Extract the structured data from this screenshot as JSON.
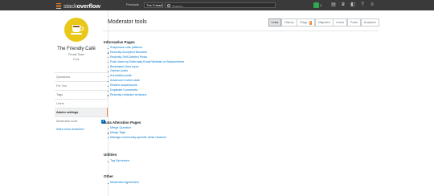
{
  "topbar": {
    "logo_prefix": "stack",
    "logo_brand": "overflow",
    "products_label": "Products",
    "site_name": "The Friendly Café",
    "site_close": "×",
    "search_placeholder": "Search...",
    "reputation": "1",
    "icons": [
      "inbox-icon",
      "achievements-icon",
      "review-icon",
      "help-icon",
      "site-switcher-icon"
    ],
    "colors": {
      "bar": "#3a3a3a",
      "accent": "#f48024"
    }
  },
  "profile": {
    "team_name": "The Friendly Café",
    "private_team_label": "Private Team",
    "role_label": "Free"
  },
  "sidebar": {
    "items": [
      {
        "label": "Questions",
        "active": false
      },
      {
        "label": "For You",
        "active": false
      },
      {
        "label": "Tags",
        "active": false
      },
      {
        "label": "Users",
        "active": false
      },
      {
        "label": "Admin settings",
        "active": true
      },
      {
        "label": "Moderator tools",
        "active": false,
        "badge": "1"
      }
    ],
    "feedback_label": "Want more features?"
  },
  "main": {
    "title": "Moderator tools",
    "tabs": [
      {
        "label": "Links",
        "active": true
      },
      {
        "label": "History",
        "active": false
      },
      {
        "label": "Flags",
        "active": false,
        "count": "1"
      },
      {
        "label": "Migrated",
        "active": false
      },
      {
        "label": "Users",
        "active": false
      },
      {
        "label": "Posts",
        "active": false
      },
      {
        "label": "Analytics",
        "active": false
      }
    ],
    "sections": [
      {
        "heading": "Informative Pages",
        "links": [
          "Suspicious vote patterns",
          "Recently Accepted Bounties",
          "Recently Self-Deleted Posts",
          "Post Users by Externally Email Website or Stackscheme",
          "Backdated User Input",
          "Orphan posts",
          "Annotated posts",
          "Advanced review stats",
          "Review suspensions",
          "Duplicate Comments",
          "Recently redacted revisions"
        ]
      },
      {
        "heading": "Data Alteration Pages",
        "links": [
          "Merge Question",
          "Merge Tags",
          "Manage community-specific close reasons"
        ]
      },
      {
        "heading": "Utilities",
        "links": [
          "Tag Synonyms"
        ]
      },
      {
        "heading": "Other",
        "links": [
          "Moderator Agreement"
        ]
      }
    ]
  }
}
